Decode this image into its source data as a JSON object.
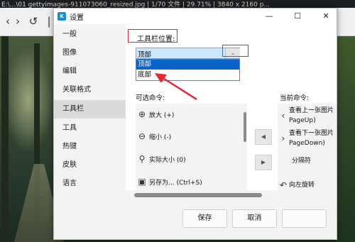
{
  "viewer": {
    "title": "E:\\...\\01 gettyimages-911073060_resized.jpg | 1/70 文件 | 29.71% | 3840 x 2160 p..."
  },
  "dialog": {
    "title": "设置",
    "app_icon": "K",
    "minimize": "—",
    "maximize": "☐",
    "close": "✕"
  },
  "nav": {
    "items": [
      {
        "label": "一般"
      },
      {
        "label": "图像"
      },
      {
        "label": "编辑"
      },
      {
        "label": "关联格式"
      },
      {
        "label": "工具栏"
      },
      {
        "label": "工具"
      },
      {
        "label": "热键"
      },
      {
        "label": "皮肤"
      },
      {
        "label": "语言"
      }
    ],
    "selected": "工具栏"
  },
  "toolbar_settings": {
    "position_label": "工具栏位置:",
    "position_value": "顶部",
    "position_options": [
      "顶部",
      "底部"
    ],
    "available_label": "可选命令:",
    "current_label": "当前命令:",
    "available_commands": [
      {
        "icon": "zoom-in-icon",
        "glyph": "⊕",
        "label": "放大 (+)"
      },
      {
        "icon": "zoom-out-icon",
        "glyph": "⊖",
        "label": "缩小 (-)"
      },
      {
        "icon": "actual-size-icon",
        "glyph": "⚲",
        "label": "实际大小 (0)"
      },
      {
        "icon": "save-icon",
        "glyph": "▣",
        "label": "另存为... (Ctrl+S)"
      }
    ],
    "current_commands": [
      {
        "icon": "prev-icon",
        "glyph": "‹",
        "label_line1": "查看上一张图片",
        "label_line2": "PageUp)"
      },
      {
        "icon": "next-icon",
        "glyph": "›",
        "label_line1": "查看下一张图片",
        "label_line2": "PageDown)"
      },
      {
        "icon": "",
        "glyph": "",
        "label_line1": "分隔符",
        "label_line2": ""
      },
      {
        "icon": "rotate-icon",
        "glyph": "↶",
        "label_line1": "向左旋转",
        "label_line2": ""
      }
    ],
    "move_left": "◀",
    "move_right": "▶"
  },
  "footer": {
    "save": "保存",
    "cancel": "取消",
    "apply": ""
  },
  "colors": {
    "annotation_red": "#e8262e",
    "highlight_blue": "#0a63c9",
    "select_bg": "#cce8ff"
  }
}
